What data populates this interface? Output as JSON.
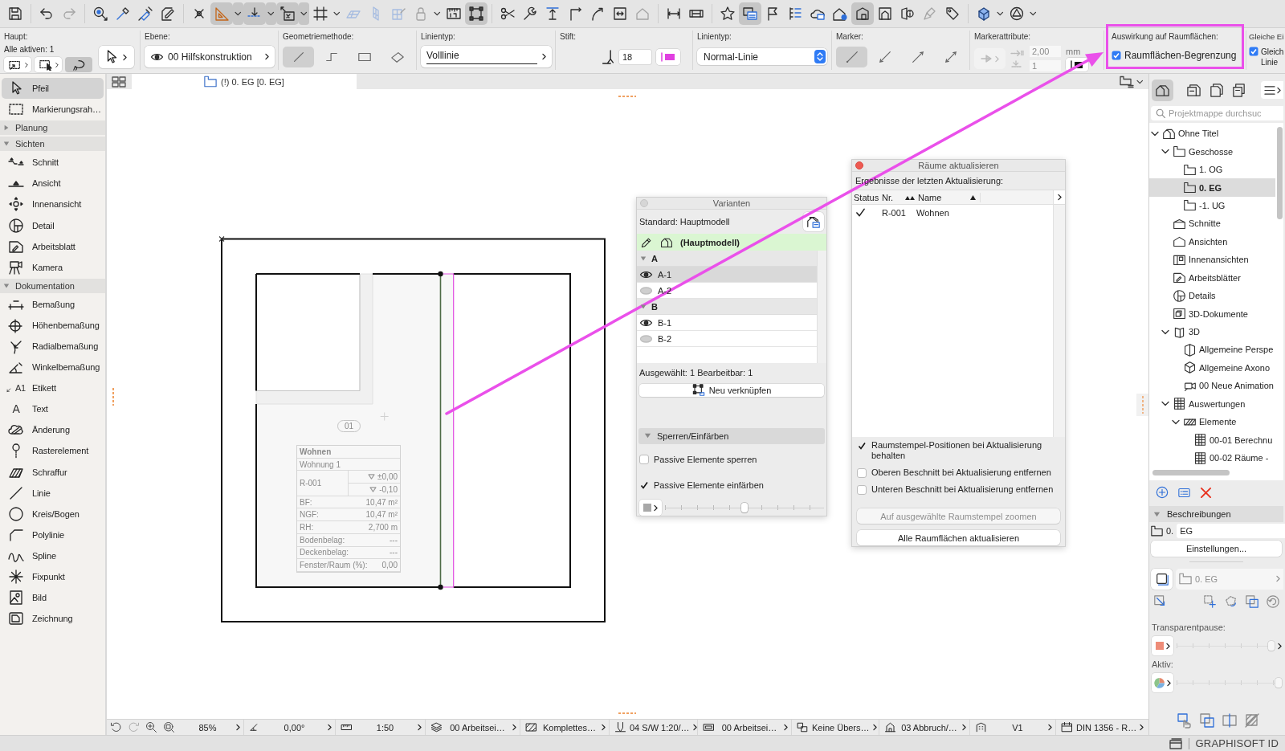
{
  "toolbar": {
    "groups": [
      {
        "buttons": [
          {
            "selected": false,
            "disabled": false,
            "menu": false
          }
        ]
      },
      {
        "buttons": [
          {
            "selected": false,
            "disabled": false,
            "menu": false
          },
          {
            "selected": false,
            "disabled": true,
            "menu": false
          }
        ]
      },
      {
        "buttons": [
          {
            "selected": false,
            "disabled": false,
            "menu": false
          },
          {
            "selected": false,
            "disabled": false,
            "menu": false
          },
          {
            "selected": false,
            "disabled": false,
            "menu": false
          },
          {
            "selected": false,
            "disabled": false,
            "menu": false
          }
        ]
      },
      {
        "buttons": [
          {
            "selected": false,
            "disabled": false,
            "menu": false
          },
          {
            "selected": true,
            "disabled": false,
            "menu": true
          },
          {
            "selected": true,
            "disabled": false,
            "menu": true
          },
          {
            "selected": true,
            "disabled": false,
            "menu": true
          },
          {
            "selected": false,
            "disabled": false,
            "menu": true
          },
          {
            "selected": false,
            "disabled": true,
            "menu": false
          },
          {
            "selected": false,
            "disabled": true,
            "menu": false
          },
          {
            "selected": false,
            "disabled": true,
            "menu": false
          },
          {
            "selected": false,
            "disabled": true,
            "menu": true
          },
          {
            "selected": false,
            "disabled": false,
            "menu": false
          },
          {
            "selected": true,
            "disabled": false,
            "menu": false
          }
        ]
      },
      {
        "buttons": [
          {
            "selected": false,
            "disabled": false,
            "menu": false
          },
          {
            "selected": false,
            "disabled": false,
            "menu": false
          },
          {
            "selected": false,
            "disabled": false,
            "menu": false
          },
          {
            "selected": false,
            "disabled": false,
            "menu": false
          },
          {
            "selected": false,
            "disabled": false,
            "menu": false
          },
          {
            "selected": false,
            "disabled": false,
            "menu": false
          },
          {
            "selected": false,
            "disabled": true,
            "menu": false
          }
        ]
      },
      {
        "buttons": [
          {
            "selected": false,
            "disabled": false,
            "menu": false
          },
          {
            "selected": false,
            "disabled": false,
            "menu": false
          }
        ]
      },
      {
        "buttons": [
          {
            "selected": false,
            "disabled": false,
            "menu": false
          },
          {
            "selected": true,
            "disabled": false,
            "menu": false
          },
          {
            "selected": false,
            "disabled": false,
            "menu": false
          },
          {
            "selected": false,
            "disabled": false,
            "menu": false
          },
          {
            "selected": false,
            "disabled": false,
            "menu": false
          },
          {
            "selected": false,
            "disabled": false,
            "menu": false
          },
          {
            "selected": true,
            "disabled": false,
            "menu": false
          },
          {
            "selected": false,
            "disabled": false,
            "menu": false
          },
          {
            "selected": false,
            "disabled": false,
            "menu": false
          },
          {
            "selected": false,
            "disabled": true,
            "menu": false
          },
          {
            "selected": false,
            "disabled": false,
            "menu": false
          }
        ]
      },
      {
        "buttons": [
          {
            "selected": false,
            "disabled": false,
            "menu": true
          },
          {
            "selected": false,
            "disabled": false,
            "menu": true
          }
        ]
      }
    ]
  },
  "info_box": {
    "main": {
      "label": "Haupt:",
      "active": "Alle aktiven: 1",
      "filters": [
        {
          "selected": false
        },
        {
          "selected": false
        },
        {
          "selected": true
        }
      ]
    },
    "layer": {
      "label": "Ebene:",
      "value": "00 Hilfskonstruktion"
    },
    "geometry": {
      "label": "Geometriemethode:",
      "methods": [
        {
          "selected": true
        },
        {
          "selected": false
        },
        {
          "selected": false
        },
        {
          "selected": false
        }
      ]
    },
    "line_type": {
      "label": "Linientyp:",
      "value": "Volllinie"
    },
    "pen": {
      "label": "Stift:",
      "value": "18"
    },
    "line_kind": {
      "label": "Linientyp:",
      "value": "Normal-Linie"
    },
    "marker": {
      "label": "Marker:",
      "options": [
        {
          "selected": true
        },
        {
          "selected": false
        },
        {
          "selected": false
        },
        {
          "selected": false
        }
      ]
    },
    "marker_attributes": {
      "label": "Markerattribute:",
      "size": "2,00",
      "unit": "mm",
      "pen": "1"
    },
    "room_effect": {
      "label": "Auswirkung auf Raumflächen:",
      "option": {
        "label": "Raumflächen-Begrenzung",
        "checked": true
      }
    },
    "same_settings": {
      "label": "Gleiche Ei",
      "option": {
        "label": "Gleich Linie",
        "checked": true
      }
    }
  },
  "view_tabs": [
    {
      "label": "(!) 0. EG [0. EG]",
      "selected": true
    }
  ],
  "toolbox": {
    "tools": [
      {
        "label": "Pfeil",
        "selected": true
      },
      {
        "label": "Markierungsrah…",
        "selected": false
      }
    ],
    "sections": [
      {
        "label": "Planung",
        "expanded": false
      },
      {
        "label": "Sichten",
        "expanded": true,
        "tools": [
          {
            "label": "Schnitt",
            "selected": false
          },
          {
            "label": "Ansicht",
            "selected": false
          },
          {
            "label": "Innenansicht",
            "selected": false
          },
          {
            "label": "Detail",
            "selected": false
          },
          {
            "label": "Arbeitsblatt",
            "selected": false
          },
          {
            "label": "Kamera",
            "selected": false
          }
        ]
      },
      {
        "label": "Dokumentation",
        "expanded": true,
        "tools": [
          {
            "label": "Bemaßung",
            "selected": false
          },
          {
            "label": "Höhenbemaßung",
            "selected": false
          },
          {
            "label": "Radialbemaßung",
            "selected": false
          },
          {
            "label": "Winkelbemaßung",
            "selected": false
          },
          {
            "label": "Etikett",
            "selected": false,
            "glyph": "A1"
          },
          {
            "label": "Text",
            "selected": false,
            "glyph": "A"
          },
          {
            "label": "Änderung",
            "selected": false
          },
          {
            "label": "Rasterelement",
            "selected": false
          },
          {
            "label": "Schraffur",
            "selected": false
          },
          {
            "label": "Linie",
            "selected": false
          },
          {
            "label": "Kreis/Bogen",
            "selected": false
          },
          {
            "label": "Polylinie",
            "selected": false
          },
          {
            "label": "Spline",
            "selected": false
          },
          {
            "label": "Fixpunkt",
            "selected": false
          },
          {
            "label": "Bild",
            "selected": false
          },
          {
            "label": "Zeichnung",
            "selected": false
          }
        ]
      }
    ]
  },
  "plan": {
    "zone": "01",
    "room_stamp": {
      "name": "Wohnen",
      "subtitle": "Wohnung 1",
      "number": "R-001",
      "levels": [
        "±0,00",
        "-0,10"
      ],
      "rows": [
        {
          "label": "BF:",
          "value": "10,47 m²"
        },
        {
          "label": "NGF:",
          "value": "10,47 m²"
        },
        {
          "label": "RH:",
          "value": "2,700 m"
        },
        {
          "label": "Bodenbelag:",
          "value": "---"
        },
        {
          "label": "Deckenbelag:",
          "value": "---"
        },
        {
          "label": "Fenster/Raum (%):",
          "value": "0,00"
        }
      ]
    }
  },
  "variants_panel": {
    "title": "Varianten",
    "standard": "Standard: Hauptmodell",
    "current": "(Hauptmodell)",
    "groups": [
      {
        "label": "A",
        "expanded": true,
        "variants": [
          {
            "label": "A-1",
            "visible": true,
            "selected": true
          },
          {
            "label": "A-2",
            "visible": false,
            "selected": false
          }
        ]
      },
      {
        "label": "B",
        "expanded": true,
        "variants": [
          {
            "label": "B-1",
            "visible": true,
            "selected": false
          },
          {
            "label": "B-2",
            "visible": false,
            "selected": false
          }
        ]
      }
    ],
    "selection_info": "Ausgewählt: 1 Bearbeitbar: 1",
    "relink_button": "Neu verknüpfen",
    "lock_section": {
      "label": "Sperren/Einfärben",
      "expanded": true,
      "options": [
        {
          "label": "Passive Elemente sperren",
          "checked": false
        },
        {
          "label": "Passive Elemente einfärben",
          "checked": true
        }
      ],
      "opacity": {
        "level": 0.5
      }
    }
  },
  "update_rooms_panel": {
    "title": "Räume aktualisieren",
    "heading": "Ergebnisse der letzten Aktualisierung:",
    "columns": [
      "Status",
      "Nr.",
      "Name"
    ],
    "rows": [
      {
        "done": true,
        "number": "R-001",
        "name": "Wohnen"
      }
    ],
    "options": [
      {
        "label": "Raumstempel-Positionen bei Aktualisierung behalten",
        "checked": true
      },
      {
        "label": "Oberen Beschnitt bei Aktualisierung entfernen",
        "checked": false
      },
      {
        "label": "Unteren Beschnitt bei Aktualisierung entfernen",
        "checked": false
      }
    ],
    "buttons": [
      {
        "label": "Auf ausgewählte Raumstempel zoomen",
        "disabled": true
      },
      {
        "label": "Alle Raumflächen aktualisieren",
        "disabled": false
      }
    ]
  },
  "navigator": {
    "tabs": [
      {
        "selected": true
      },
      {
        "selected": false
      },
      {
        "selected": false
      },
      {
        "selected": false
      }
    ],
    "search": {
      "placeholder": "Projektmappe durchsuc"
    },
    "tree": [
      {
        "kind": "project",
        "label": "Ohne Titel",
        "expanded": true,
        "selected": false,
        "children": [
          {
            "kind": "stories",
            "label": "Geschosse",
            "expanded": true,
            "selected": false,
            "children": [
              {
                "kind": "story",
                "label": "1. OG",
                "selected": false
              },
              {
                "kind": "story",
                "label": "0. EG",
                "selected": true
              },
              {
                "kind": "story",
                "label": "-1. UG",
                "selected": false
              }
            ]
          },
          {
            "kind": "sections",
            "label": "Schnitte",
            "selected": false
          },
          {
            "kind": "elevations",
            "label": "Ansichten",
            "selected": false
          },
          {
            "kind": "interior",
            "label": "Innenansichten",
            "selected": false
          },
          {
            "kind": "worksheets",
            "label": "Arbeitsblätter",
            "selected": false
          },
          {
            "kind": "details",
            "label": "Details",
            "selected": false
          },
          {
            "kind": "documents3d",
            "label": "3D-Dokumente",
            "selected": false
          },
          {
            "kind": "model3d",
            "label": "3D",
            "expanded": true,
            "selected": false,
            "children": [
              {
                "kind": "perspective",
                "label": "Allgemeine Perspe",
                "selected": false
              },
              {
                "kind": "axonometry",
                "label": "Allgemeine Axono",
                "selected": false
              },
              {
                "kind": "animation",
                "label": "00 Neue Animation",
                "selected": false
              }
            ]
          },
          {
            "kind": "schedules",
            "label": "Auswertungen",
            "expanded": true,
            "selected": false,
            "children": [
              {
                "kind": "elements",
                "label": "Elemente",
                "expanded": true,
                "selected": false,
                "children": [
                  {
                    "kind": "schedule",
                    "label": "00-01 Berechnu",
                    "selected": false
                  },
                  {
                    "kind": "schedule",
                    "label": "00-02 Räume -",
                    "selected": false
                  }
                ]
              }
            ]
          }
        ]
      }
    ],
    "description": {
      "label": "Beschreibungen",
      "expanded": true,
      "number": "0.",
      "name": "EG",
      "settings_button": "Einstellungen..."
    },
    "story_select": "0. EG",
    "trace": {
      "label": "Transparentpause:",
      "level": 1
    },
    "active": {
      "label": "Aktiv:",
      "level": 1
    },
    "account": "GRAPHISOFT ID"
  },
  "status_bar": {
    "items": [
      {
        "value": "85%"
      },
      {
        "value": "0,00°"
      },
      {
        "value": "1:50"
      },
      {
        "value": "00 Arbeitsei…"
      },
      {
        "value": "Komplettes…"
      },
      {
        "value": "04 S/W 1:20/…"
      },
      {
        "value": "00 Arbeitsei…"
      },
      {
        "value": "Keine Übers…"
      },
      {
        "value": "03 Abbruch/…"
      },
      {
        "value": "V1"
      },
      {
        "value": "DIN 1356 - R…"
      }
    ]
  }
}
